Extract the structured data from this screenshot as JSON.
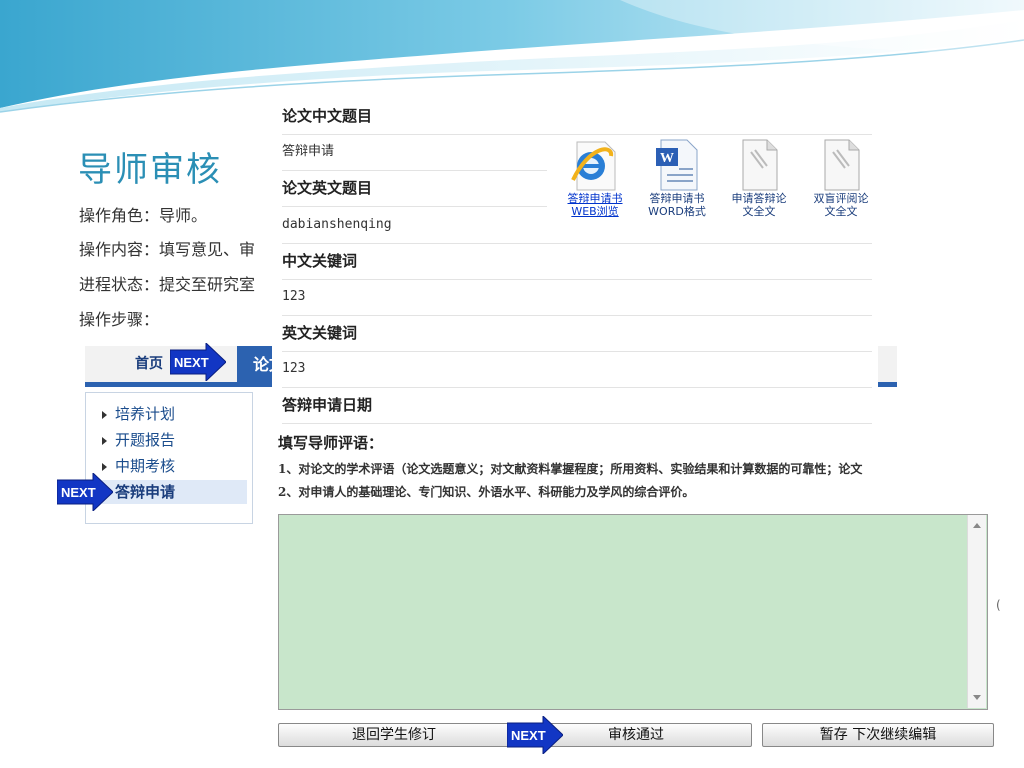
{
  "slide": {
    "title": "导师审核",
    "role": "操作角色：导师。",
    "content": "操作内容：填写意见、审",
    "status": "进程状态：提交至研究室",
    "steps": "操作步骤："
  },
  "nav": {
    "home": "首页",
    "next_badge": "NEXT",
    "cut_label": "论文"
  },
  "sidemenu": {
    "items": [
      {
        "label": "培养计划"
      },
      {
        "label": "开题报告"
      },
      {
        "label": "中期考核"
      },
      {
        "label": "答辩申请"
      }
    ]
  },
  "form": {
    "rows": [
      {
        "label": "论文中文题目",
        "value": "答辩申请"
      },
      {
        "label": "论文英文题目",
        "value": "dabianshenqing"
      },
      {
        "label": "中文关键词",
        "value": "123"
      },
      {
        "label": "英文关键词",
        "value": "123"
      },
      {
        "label": "答辩申请日期",
        "value": ""
      }
    ]
  },
  "docs": [
    {
      "icon": "ie-icon",
      "line1": "答辩申请书",
      "line2": "WEB浏览"
    },
    {
      "icon": "word-icon",
      "line1": "答辩申请书",
      "line2": "WORD格式"
    },
    {
      "icon": "document-icon",
      "line1": "申请答辩论",
      "line2": "文全文"
    },
    {
      "icon": "document-icon",
      "line1": "双盲评阅论",
      "line2": "文全文"
    }
  ],
  "comments": {
    "title": "填写导师评语：",
    "line1": "1、对论文的学术评语（论文选题意义；对文献资料掌握程度；所用资料、实验结果和计算数据的可靠性；论文",
    "line2": "2、对申请人的基础理论、专门知识、外语水平、科研能力及学风的综合评价。",
    "textarea_value": "",
    "side_char": "("
  },
  "buttons": {
    "return": "退回学生修订",
    "approve": "审核通过",
    "save": "暂存 下次继续编辑"
  },
  "colors": {
    "title": "#2b8fb5",
    "nav_blue": "#2c62b0",
    "textarea_bg": "#c8e6cb"
  }
}
